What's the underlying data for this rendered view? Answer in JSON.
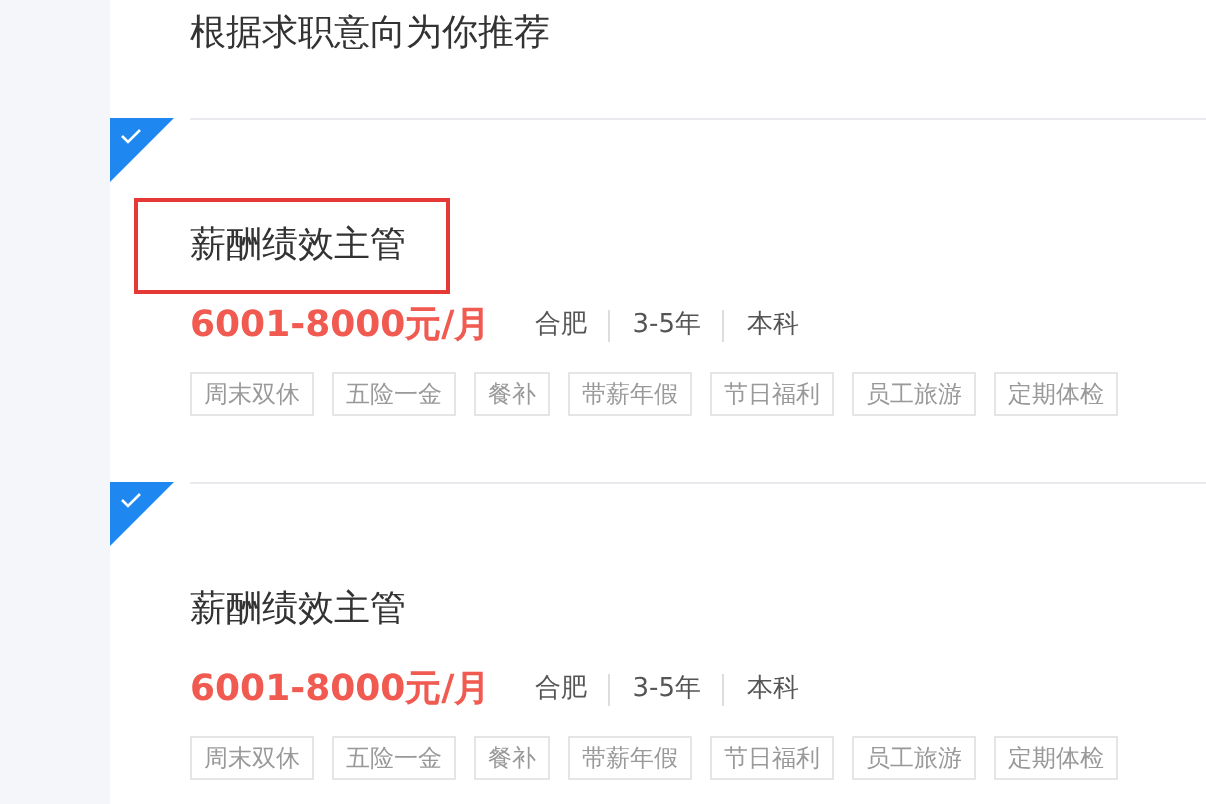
{
  "heading": "根据求职意向为你推荐",
  "jobs": [
    {
      "selected": true,
      "highlighted": true,
      "title": "薪酬绩效主管",
      "salary": "6001-8000元/月",
      "meta": [
        "合肥",
        "3-5年",
        "本科"
      ],
      "tags": [
        "周末双休",
        "五险一金",
        "餐补",
        "带薪年假",
        "节日福利",
        "员工旅游",
        "定期体检"
      ]
    },
    {
      "selected": true,
      "highlighted": false,
      "title": "薪酬绩效主管",
      "salary": "6001-8000元/月",
      "meta": [
        "合肥",
        "3-5年",
        "本科"
      ],
      "tags": [
        "周末双休",
        "五险一金",
        "餐补",
        "带薪年假",
        "节日福利",
        "员工旅游",
        "定期体检"
      ]
    }
  ]
}
